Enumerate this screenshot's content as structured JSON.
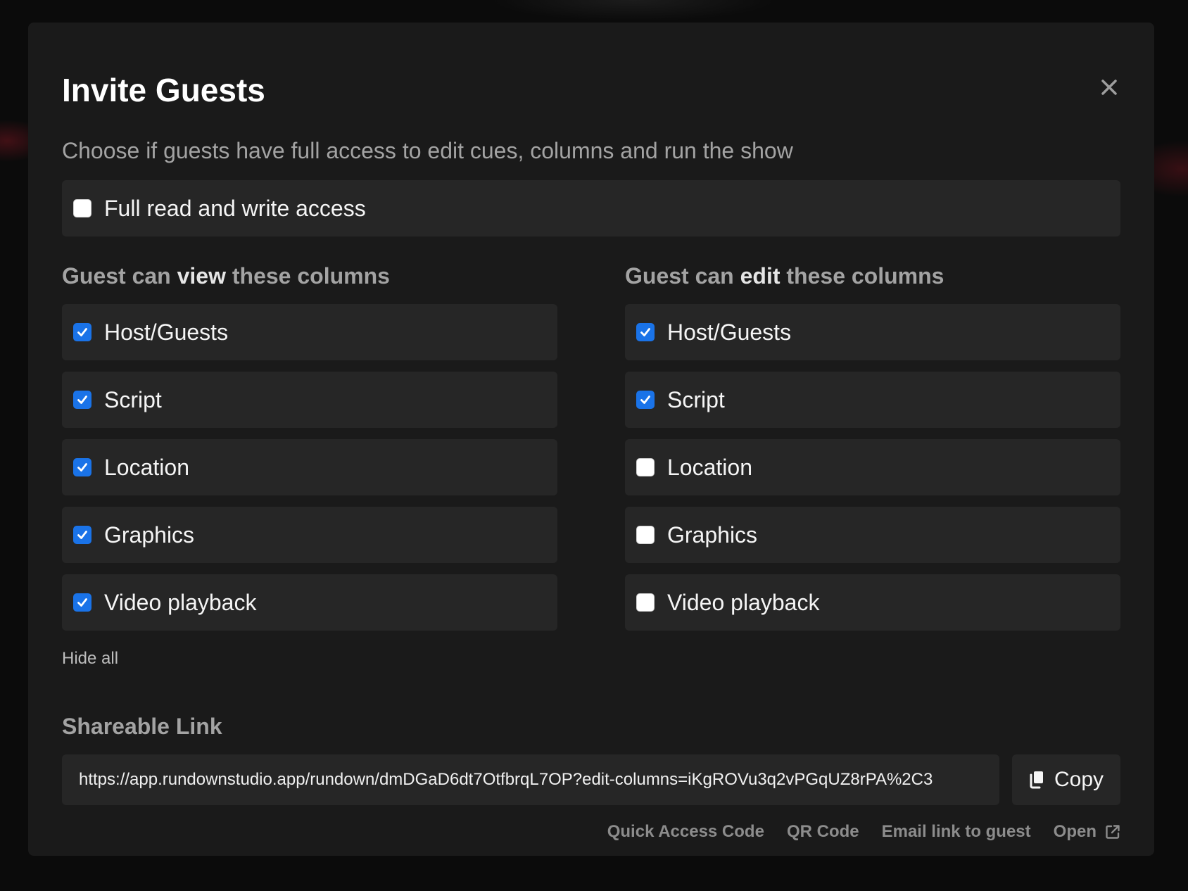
{
  "dialog": {
    "title": "Invite Guests",
    "subtitle": "Choose if guests have full access to edit cues, columns and run the show",
    "full_access": {
      "label": "Full read and write access",
      "checked": false
    }
  },
  "view_columns": {
    "header_prefix": "Guest can ",
    "header_bold": "view",
    "header_suffix": " these columns",
    "items": [
      {
        "label": "Host/Guests",
        "checked": true
      },
      {
        "label": "Script",
        "checked": true
      },
      {
        "label": "Location",
        "checked": true
      },
      {
        "label": "Graphics",
        "checked": true
      },
      {
        "label": "Video playback",
        "checked": true
      }
    ],
    "hide_all_label": "Hide all"
  },
  "edit_columns": {
    "header_prefix": "Guest can ",
    "header_bold": "edit",
    "header_suffix": " these columns",
    "items": [
      {
        "label": "Host/Guests",
        "checked": true
      },
      {
        "label": "Script",
        "checked": true
      },
      {
        "label": "Location",
        "checked": false
      },
      {
        "label": "Graphics",
        "checked": false
      },
      {
        "label": "Video playback",
        "checked": false
      }
    ]
  },
  "share": {
    "label": "Shareable Link",
    "url": "https://app.rundownstudio.app/rundown/dmDGaD6dt7OtfbrqL7OP?edit-columns=iKgROVu3q2vPGqUZ8rPA%2C3",
    "copy_label": "Copy",
    "links": {
      "quick_access": "Quick Access Code",
      "qr_code": "QR Code",
      "email": "Email link to guest",
      "open": "Open"
    }
  },
  "colors": {
    "accent": "#1a73e8",
    "modal_bg": "#1a1a1a",
    "row_bg": "#262626"
  }
}
